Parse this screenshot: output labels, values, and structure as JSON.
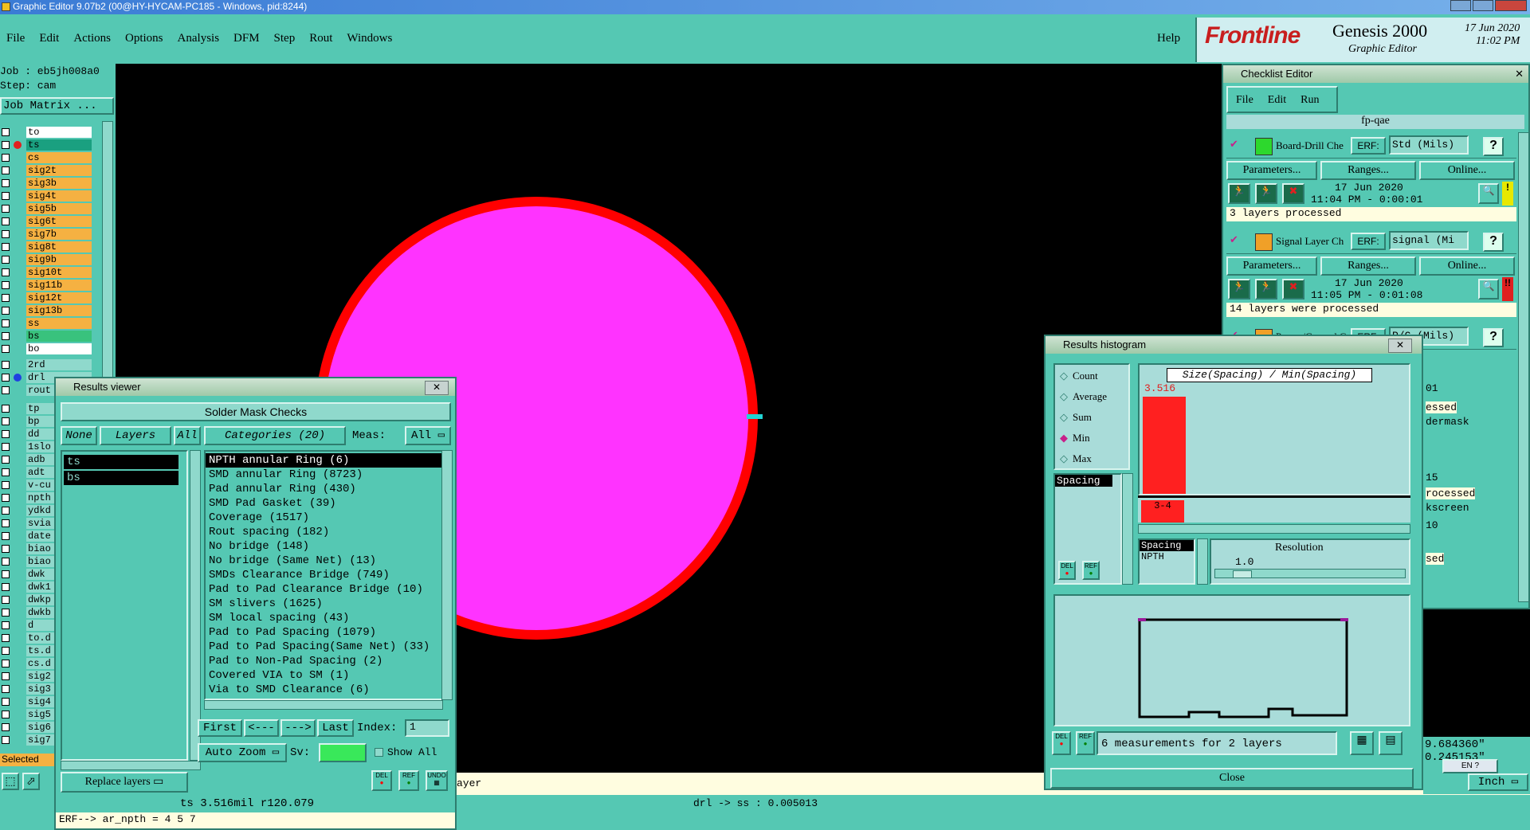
{
  "app": {
    "title_bar": "Graphic Editor 9.07b2 (00@HY-HYCAM-PC185 - Windows, pid:8244)",
    "menu": [
      "File",
      "Edit",
      "Actions",
      "Options",
      "Analysis",
      "DFM",
      "Step",
      "Rout",
      "Windows"
    ],
    "help": "Help",
    "brand": "Frontline",
    "product": "Genesis 2000",
    "product_sub": "Graphic Editor",
    "date": "17 Jun 2020",
    "time": "11:02 PM"
  },
  "left_panel": {
    "job": "Job : eb5jh008a0",
    "step": "Step: cam",
    "job_matrix": "Job Matrix ...",
    "layers_top": [
      "to",
      "ts",
      "cs",
      "sig2t",
      "sig3b",
      "sig4t",
      "sig5b",
      "sig6t",
      "sig7b",
      "sig8t",
      "sig9b",
      "sig10t",
      "sig11b",
      "sig12t",
      "sig13b",
      "ss",
      "bs",
      "bo"
    ],
    "layers_drill": [
      "2rd",
      "drl",
      "rout"
    ],
    "layers_misc": [
      "tp",
      "bp",
      "dd",
      "1slo",
      "adb",
      "adt",
      "v-cu",
      "npth",
      "ydkd",
      "svia",
      "date",
      "biao",
      "biao",
      "dwk",
      "dwk1",
      "dwkp",
      "dwkb",
      "d",
      "to.d",
      "ts.d",
      "cs.d",
      "sig2",
      "sig3",
      "sig4",
      "sig5",
      "sig6",
      "sig7"
    ],
    "selected": "Selected"
  },
  "results_viewer": {
    "title": "Results viewer",
    "header": "Solder Mask Checks",
    "none": "None",
    "layers": "Layers",
    "all": "All",
    "categories": "Categories (20)",
    "meas_label": "Meas:",
    "meas_value": "All",
    "layer_items": [
      "ts",
      "bs"
    ],
    "category_items": [
      "NPTH annular Ring (6)",
      "SMD annular Ring (8723)",
      "Pad annular Ring (430)",
      "SMD Pad Gasket (39)",
      "Coverage (1517)",
      "Rout spacing (182)",
      "No bridge (148)",
      "No bridge (Same Net) (13)",
      "SMDs Clearance Bridge (749)",
      "Pad to Pad Clearance Bridge (10)",
      "SM slivers (1625)",
      "SM local spacing (43)",
      "Pad to Pad Spacing (1079)",
      "Pad to Pad Spacing(Same Net) (33)",
      "Pad to Non-Pad Spacing (2)",
      "Covered VIA to SM (1)",
      "Via to SMD Clearance (6)"
    ],
    "first": "First",
    "prev": "<---",
    "next": "--->",
    "last": "Last",
    "index_label": "Index:",
    "index_value": "1",
    "zoom": "Auto Zoom",
    "sv": "Sv:",
    "show_all": "Show All",
    "replace_layers": "Replace layers",
    "del": "DEL",
    "ref": "REF",
    "undo": "UNDO",
    "status": "ts 3.516mil  r120.079",
    "erf": "ERF--> ar_npth = 4 5 7"
  },
  "bottom_bar": {
    "layer_text": "ayer",
    "coord": "drl -> ss : 0.005013"
  },
  "checklist": {
    "title": "Checklist Editor",
    "menu": [
      "File",
      "Edit",
      "Run"
    ],
    "name": "fp-qae",
    "items": [
      {
        "name": "Board-Drill Che",
        "erf": "ERF:",
        "std": "Std (Mils)",
        "date": "17 Jun 2020",
        "time": "11:04 PM - 0:00:01",
        "result": "3 layers processed",
        "status": "!",
        "status_color": "#e8e800"
      },
      {
        "name": "Signal Layer Ch",
        "erf": "ERF:",
        "std": "signal (Mi",
        "date": "17 Jun 2020",
        "time": "11:05 PM - 0:01:08",
        "result": "14 layers were processed",
        "status": "!!",
        "status_color": "#e02020"
      },
      {
        "name": "Power/Ground C",
        "erf": "ERF:",
        "std": "P/G (Mils)",
        "date": "",
        "time": "",
        "result": "",
        "status": "",
        "status_color": "#40c040"
      }
    ],
    "params": "Parameters...",
    "ranges": "Ranges...",
    "online": "Online...",
    "partial": [
      "01",
      "essed",
      "dermask",
      "15",
      "rocessed",
      "kscreen",
      "10",
      "sed"
    ]
  },
  "histogram": {
    "title": "Results histogram",
    "options": [
      "Count",
      "Average",
      "Sum",
      "Min",
      "Max"
    ],
    "selected_option": "Min",
    "graph_title": "Size(Spacing) / Min(Spacing)",
    "bar_value": "3.516",
    "bar_label": "3-4",
    "list_item": "Spacing",
    "types": [
      "Spacing",
      "NPTH"
    ],
    "resolution_label": "Resolution",
    "resolution_value": "1.0",
    "summary": "6 measurements for 2 layers",
    "close": "Close"
  },
  "corner": {
    "coord1": "9.684360\"",
    "coord2": "0.245153\"",
    "units": "Inch",
    "lang": "EN"
  },
  "colors": {
    "panel": "#55c8b3",
    "pale_panel": "#a9dcd9",
    "layer_orange": "#f5b142",
    "pad_fill": "#ff33ff",
    "pad_ring": "#ff0000",
    "accent_red": "#ff2020"
  }
}
